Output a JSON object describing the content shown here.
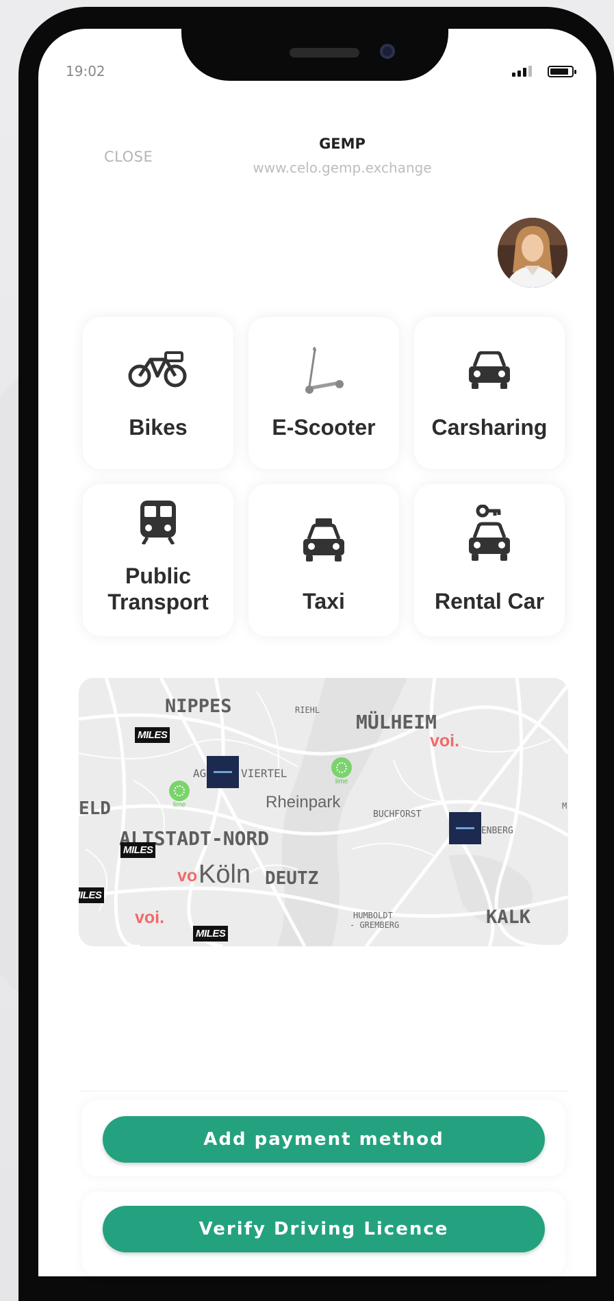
{
  "status_bar": {
    "time": "19:02"
  },
  "header": {
    "close_label": "CLOSE",
    "title": "GEMP",
    "url": "www.celo.gemp.exchange"
  },
  "profile": {
    "avatar_icon": "user-avatar"
  },
  "services": [
    {
      "label": "Bikes",
      "icon": "bike-icon"
    },
    {
      "label": "E-Scooter",
      "icon": "scooter-icon"
    },
    {
      "label": "Carsharing",
      "icon": "car-icon"
    },
    {
      "label": "Public Transport",
      "label_lines": [
        "Public",
        "Transport"
      ],
      "icon": "train-icon"
    },
    {
      "label": "Taxi",
      "icon": "taxi-icon"
    },
    {
      "label": "Rental Car",
      "icon": "rental-car-icon"
    }
  ],
  "map": {
    "districts": {
      "nippes": "NIPPES",
      "riehl": "RIEHL",
      "muelheim": "MÜLHEIM",
      "viertel_prefix": "AG",
      "viertel": "VIERTEL",
      "rheinpark": "Rheinpark",
      "buchforst": "BUCHFORST",
      "feld": "ELD",
      "altstadt": "ALTSTADT-NORD",
      "henberg": "HENBERG",
      "koeln": "Köln",
      "deutz": "DEUTZ",
      "humboldt": "HUMBOLDT",
      "gremberg": "- GREMBERG",
      "kalk": "KALK",
      "edge_m": "M"
    },
    "providers": {
      "miles": "MILES",
      "voi": "voi.",
      "lime": "lime",
      "tier": "TIER"
    }
  },
  "actions": {
    "add_payment": "Add payment method",
    "verify_licence": "Verify Driving Licence"
  },
  "colors": {
    "accent": "#24a27f",
    "tier": "#1b2a4e",
    "voi": "#ef6a6a",
    "lime": "#7bd36b"
  }
}
